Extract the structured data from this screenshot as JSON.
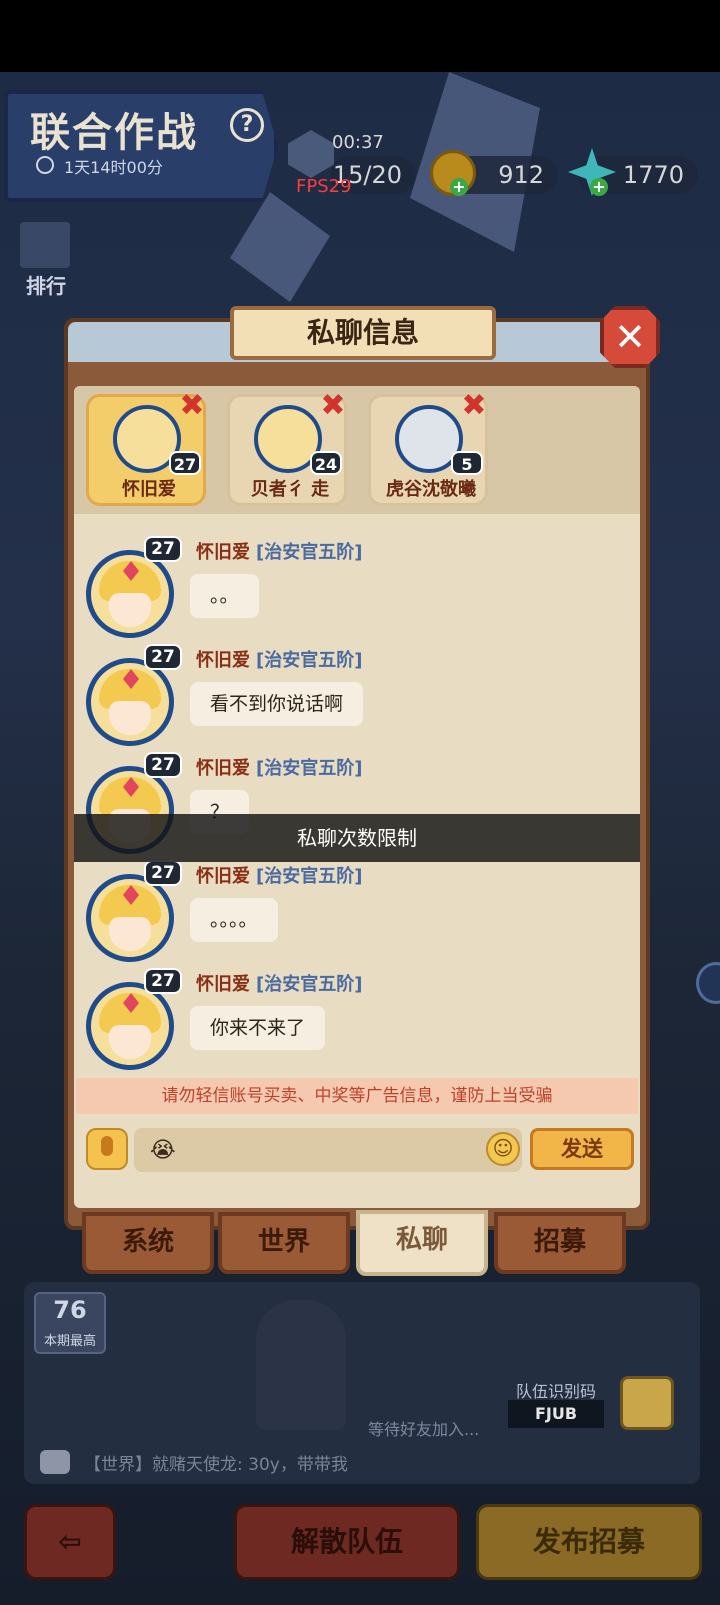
{
  "hud": {
    "title": "联合作战",
    "help_glyph": "?",
    "event_timer": "1天14时00分",
    "stamina_timer": "00:37",
    "stamina": "15/20",
    "fps": "FPS29",
    "coins": "912",
    "gems": "1770",
    "rank_label": "排行",
    "plus": "+"
  },
  "dialog": {
    "title": "私聊信息",
    "close_glyph": "✕",
    "contacts": [
      {
        "name": "怀旧爱",
        "level": "27",
        "remove": "✖"
      },
      {
        "name": "贝者彳 走",
        "level": "24",
        "remove": "✖"
      },
      {
        "name": "虎谷沈敬曦",
        "level": "5",
        "remove": "✖"
      }
    ],
    "messages": [
      {
        "level": "27",
        "name": "怀旧爱",
        "rank": "[治安官五阶]",
        "text": "。。"
      },
      {
        "level": "27",
        "name": "怀旧爱",
        "rank": "[治安官五阶]",
        "text": "看不到你说话啊"
      },
      {
        "level": "27",
        "name": "怀旧爱",
        "rank": "[治安官五阶]",
        "text": "？"
      },
      {
        "level": "27",
        "name": "怀旧爱",
        "rank": "[治安官五阶]",
        "text": "。。。。"
      },
      {
        "level": "27",
        "name": "怀旧爱",
        "rank": "[治安官五阶]",
        "text": "你来不来了"
      }
    ],
    "toast": "私聊次数限制",
    "warning": "请勿轻信账号买卖、中奖等广告信息，谨防上当受骗",
    "input_value": "😭",
    "emoji_glyph": "☺",
    "send_label": "发送",
    "tabs": [
      {
        "label": "系统",
        "active": false
      },
      {
        "label": "世界",
        "active": false
      },
      {
        "label": "私聊",
        "active": true
      },
      {
        "label": "招募",
        "active": false
      }
    ]
  },
  "team": {
    "best_score": "76",
    "best_label": "本期最高",
    "waiting": "等待好友加入...",
    "code_label": "队伍识别码",
    "code": "FJUB",
    "chat_ticker": "【世界】就赌天使龙: 30y，带带我"
  },
  "bottom": {
    "back_glyph": "⇦",
    "disband_label": "解散队伍",
    "recruit_label": "发布招募"
  }
}
